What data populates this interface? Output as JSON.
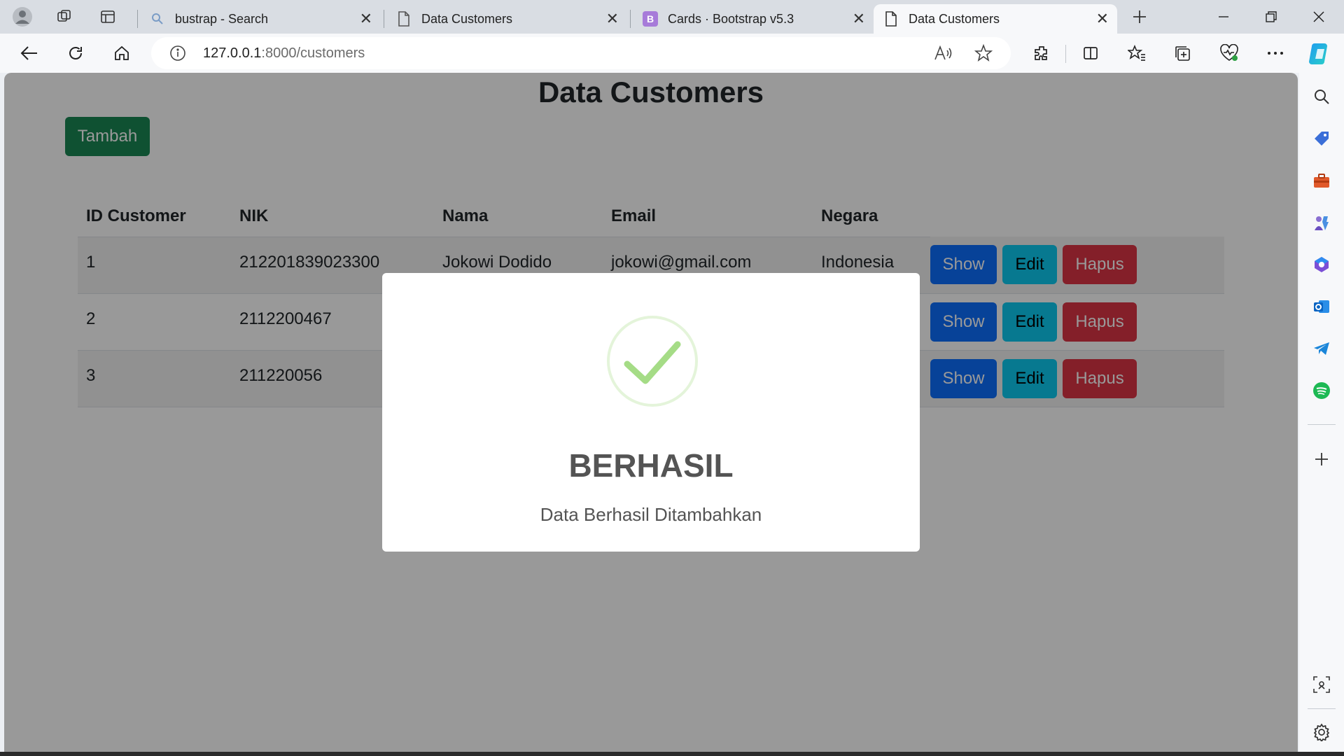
{
  "tabs": [
    {
      "label": "bustrap - Search",
      "icon": "search-icon"
    },
    {
      "label": "Data Customers",
      "icon": "page-icon"
    },
    {
      "label": "Cards · Bootstrap v5.3",
      "icon": "bootstrap-icon"
    },
    {
      "label": "Data Customers",
      "icon": "page-icon",
      "active": true
    }
  ],
  "address": {
    "host": "127.0.0.1",
    "rest": ":8000/customers"
  },
  "page": {
    "title": "Data Customers",
    "add_button": "Tambah",
    "columns": [
      "ID Customer",
      "NIK",
      "Nama",
      "Email",
      "Negara"
    ],
    "rows": [
      {
        "id": "1",
        "nik": "212201839023300",
        "nama": "Jokowi Dodido",
        "email": "jokowi@gmail.com",
        "negara": "Indonesia"
      },
      {
        "id": "2",
        "nik": "2112200467",
        "nama": "",
        "email": "",
        "negara": ""
      },
      {
        "id": "3",
        "nik": "211220056",
        "nama": "",
        "email": "",
        "negara": ""
      }
    ],
    "actions": {
      "show": "Show",
      "edit": "Edit",
      "hapus": "Hapus"
    }
  },
  "modal": {
    "title": "BERHASIL",
    "text": "Data Berhasil Ditambahkan"
  },
  "colors": {
    "success": "#198754",
    "primary": "#0d6efd",
    "info": "#0dcaf0",
    "danger": "#dc3545",
    "check": "#a5dc86"
  }
}
